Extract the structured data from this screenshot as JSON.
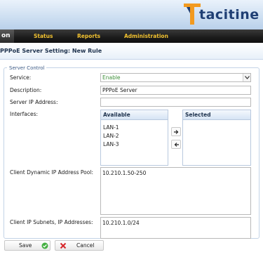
{
  "brand": {
    "logo_text": "tacitine"
  },
  "nav": {
    "active_label": "on",
    "items": [
      {
        "label": "Status"
      },
      {
        "label": "Reports"
      },
      {
        "label": "Administration"
      }
    ]
  },
  "page": {
    "title": "PPPoE Server Setting: New Rule"
  },
  "form": {
    "legend": "Server Control",
    "service": {
      "label": "Service:",
      "value": "Enable"
    },
    "description": {
      "label": "Description:",
      "value": "PPPoE Server"
    },
    "server_ip": {
      "label": "Server IP Address:",
      "value": ""
    },
    "interfaces": {
      "label": "Interfaces:",
      "available_header": "Available",
      "selected_header": "Selected",
      "available": [
        "LAN-1",
        "LAN-2",
        "LAN-3"
      ],
      "selected": []
    },
    "pool": {
      "label": "Client Dynamic IP Address Pool:",
      "value": "10.210.1.50-250"
    },
    "subnets": {
      "label": "Client IP Subnets, IP Addresses:",
      "value": "10.210.1.0/24"
    }
  },
  "buttons": {
    "save": "Save",
    "cancel": "Cancel"
  },
  "colors": {
    "nav_text": "#f2c230",
    "brand_dark": "#1f3f74",
    "brand_orange": "#f29a1f",
    "select_value": "#3f8f3a",
    "save_icon": "#45b043",
    "cancel_icon": "#d6262a"
  },
  "icons": {
    "logo": "tacitine-logo-icon",
    "dropdown": "chevron-down-icon",
    "move_right": "arrow-right-icon",
    "move_left": "arrow-left-icon",
    "save": "check-circle-icon",
    "cancel": "x-icon"
  }
}
